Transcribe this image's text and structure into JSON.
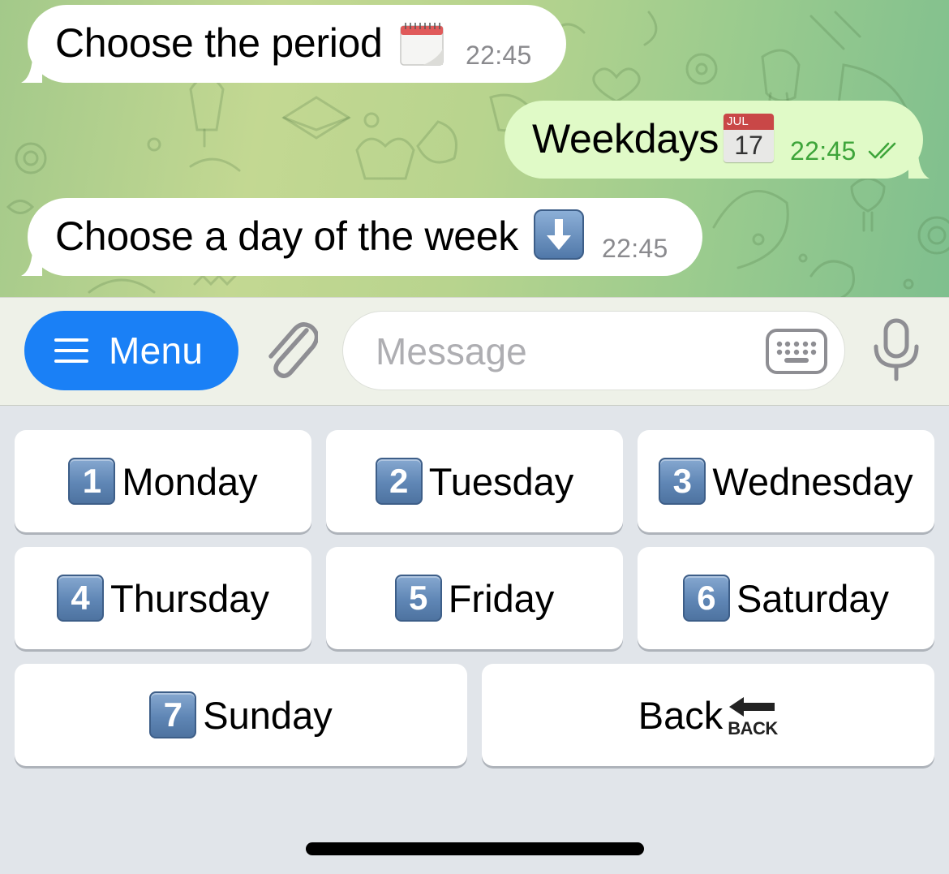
{
  "messages": [
    {
      "direction": "incoming",
      "text": "Choose the period",
      "emoji_icon": "spiral-calendar-icon",
      "time": "22:45"
    },
    {
      "direction": "outgoing",
      "text": "Weekdays",
      "emoji_icon": "calendar-jul-17-icon",
      "time": "22:45",
      "status": "read"
    },
    {
      "direction": "incoming",
      "text": "Choose a day of the week",
      "emoji_icon": "down-arrow-icon",
      "time": "22:45"
    }
  ],
  "calendar_emoji": {
    "month": "JUL",
    "day": "17"
  },
  "input_bar": {
    "menu_label": "Menu",
    "message_placeholder": "Message"
  },
  "keyboard": {
    "rows": [
      [
        {
          "number": "1",
          "label": "Monday"
        },
        {
          "number": "2",
          "label": "Tuesday"
        },
        {
          "number": "3",
          "label": "Wednesday"
        }
      ],
      [
        {
          "number": "4",
          "label": "Thursday"
        },
        {
          "number": "5",
          "label": "Friday"
        },
        {
          "number": "6",
          "label": "Saturday"
        }
      ],
      [
        {
          "number": "7",
          "label": "Sunday"
        },
        {
          "label": "Back",
          "emoji_icon": "back-arrow-icon",
          "emoji_text": "BACK"
        }
      ]
    ]
  },
  "colors": {
    "accent": "#1a80f6",
    "incoming_bubble": "#ffffff",
    "outgoing_bubble": "#e0fac7",
    "outgoing_time": "#3ea53a",
    "keyboard_bg": "#e1e5ea"
  }
}
